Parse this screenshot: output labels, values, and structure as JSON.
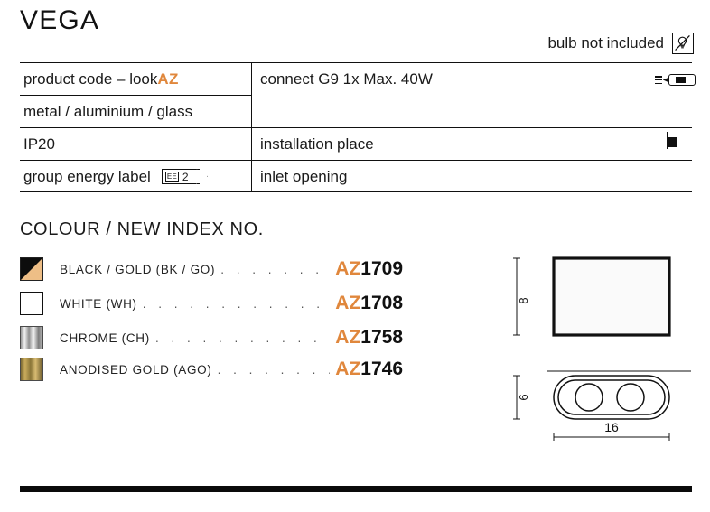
{
  "title": "VEGA",
  "bulb_note": {
    "text": "bulb not included",
    "icon": "bulb-crossed-icon"
  },
  "spec_table": {
    "left_column": [
      {
        "label": "product code – look ",
        "accent": "AZ",
        "has_accent": true
      },
      {
        "label": "metal / aluminium / glass",
        "has_accent": false
      },
      {
        "label": "IP20",
        "has_accent": false
      },
      {
        "label": "group energy label",
        "has_accent": false,
        "badge": {
          "prefix": "EE",
          "value": "2"
        }
      }
    ],
    "right_column": [
      {
        "label": "connect G9 1x Max. 40W",
        "icon": "g9-lamp-icon"
      },
      {
        "label": "installation place",
        "icon": "installation-place-icon"
      },
      {
        "label": "inlet opening",
        "icon": null
      }
    ]
  },
  "colour_section": {
    "heading": "COLOUR / NEW INDEX NO.",
    "dots": ". . . . . . . . . . . . . . . . . . .",
    "rows": [
      {
        "swatch": "black-gold-swatch",
        "name": "BLACK / GOLD (BK / GO)",
        "code_prefix": "AZ",
        "code_number": "1709"
      },
      {
        "swatch": "white-swatch",
        "name": "WHITE (WH)",
        "code_prefix": "AZ",
        "code_number": "1708"
      },
      {
        "swatch": "chrome-swatch",
        "name": "CHROME (CH)",
        "code_prefix": "AZ",
        "code_number": "1758"
      },
      {
        "swatch": "anodised-gold-swatch",
        "name": "ANODISED GOLD (AGO)",
        "code_prefix": "AZ",
        "code_number": "1746"
      }
    ]
  },
  "drawings": {
    "front_view": {
      "height_dim": "8"
    },
    "bottom_view": {
      "height_dim": "6",
      "width_dim": "16"
    }
  },
  "colors": {
    "accent_orange": "#E0873C",
    "line_black": "#111111",
    "gold": "#EEBE86"
  }
}
